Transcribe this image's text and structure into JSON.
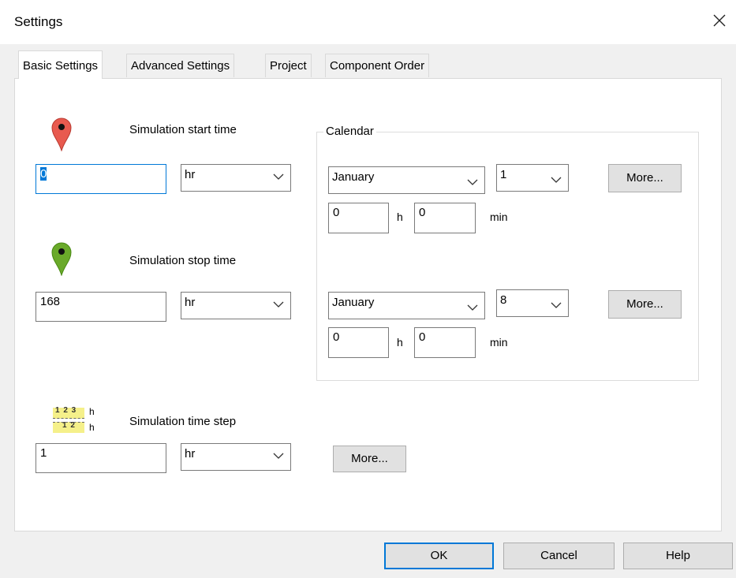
{
  "window": {
    "title": "Settings",
    "close_icon": "close-icon"
  },
  "tabs": [
    {
      "label": "Basic Settings",
      "active": true
    },
    {
      "label": "Advanced Settings",
      "active": false
    },
    {
      "label": "Project",
      "active": false
    },
    {
      "label": "Component Order",
      "active": false
    }
  ],
  "start": {
    "label": "Simulation start time",
    "icon": "red-map-pin-icon",
    "value": "0",
    "unit": "hr"
  },
  "stop": {
    "label": "Simulation stop time",
    "icon": "green-map-pin-icon",
    "value": "168",
    "unit": "hr"
  },
  "step": {
    "label": "Simulation time step",
    "icon": "ruler-icon",
    "ruler_top": "1 2 3",
    "ruler_bottom": "1 2",
    "ruler_unit_top": "h",
    "ruler_unit_bottom": "h",
    "value": "1",
    "unit": "hr",
    "more_label": "More..."
  },
  "calendar": {
    "label": "Calendar",
    "start": {
      "month": "January",
      "day": "1",
      "hours": "0",
      "h_label": "h",
      "minutes": "0",
      "min_label": "min",
      "more_label": "More..."
    },
    "stop": {
      "month": "January",
      "day": "8",
      "hours": "0",
      "h_label": "h",
      "minutes": "0",
      "min_label": "min",
      "more_label": "More..."
    }
  },
  "footer": {
    "ok_label": "OK",
    "cancel_label": "Cancel",
    "help_label": "Help"
  },
  "colors": {
    "accent": "#0078d7",
    "pin_red": "#e85a4f",
    "pin_green": "#6aaa2a",
    "ruler_yellow": "#f5f08a"
  }
}
